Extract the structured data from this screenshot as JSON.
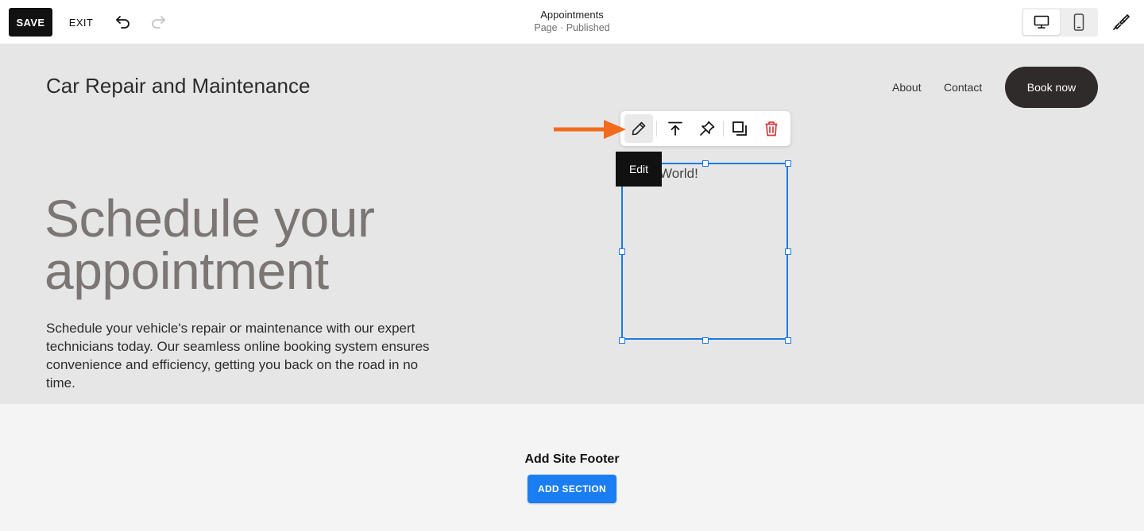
{
  "editor": {
    "save_label": "SAVE",
    "exit_label": "EXIT",
    "page_title": "Appointments",
    "page_status": "Page · Published",
    "icons": {
      "undo": "undo-icon",
      "redo": "redo-icon",
      "desktop": "desktop-icon",
      "mobile": "mobile-icon",
      "design": "paintbrush-icon"
    }
  },
  "site": {
    "title": "Car Repair and Maintenance",
    "nav": [
      {
        "label": "About"
      },
      {
        "label": "Contact"
      }
    ],
    "cta_label": "Book now"
  },
  "hero": {
    "heading": "Schedule your appointment",
    "body": "Schedule your vehicle's repair or maintenance with our expert technicians today. Our seamless online booking system ensures convenience and efficiency, getting you back on the road in no time."
  },
  "selected_block": {
    "text": "World!"
  },
  "block_toolbar": {
    "tooltip": "Edit",
    "icons": [
      "pencil-icon",
      "bring-to-front-icon",
      "pin-icon",
      "duplicate-icon",
      "trash-icon"
    ]
  },
  "footer": {
    "title": "Add Site Footer",
    "add_section_label": "ADD SECTION"
  },
  "colors": {
    "accent": "#1a7ae6",
    "arrow": "#f26a1b",
    "delete": "#d9383a",
    "cta": "#2f2b2a"
  }
}
